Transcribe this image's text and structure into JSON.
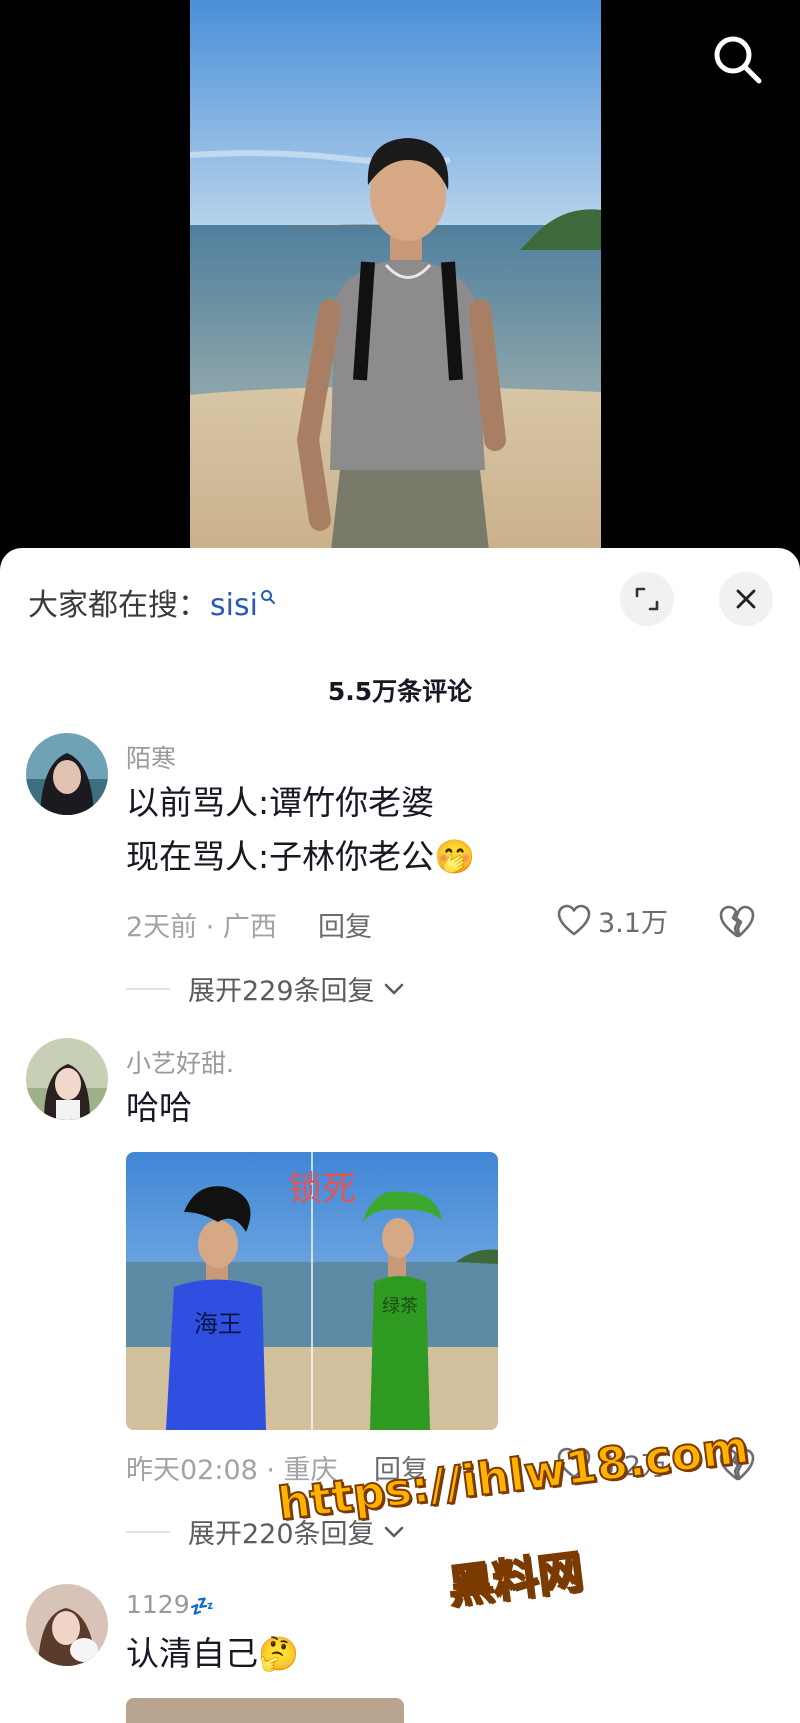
{
  "search_bar": {
    "prefix": "大家都在搜：",
    "keyword": "sisi"
  },
  "comments_header": {
    "count_label": "5.5万条评论"
  },
  "comments": [
    {
      "username": "陌寒",
      "lines": [
        "以前骂人:谭竹你老婆",
        "现在骂人:子林你老公"
      ],
      "emoji": "🤭",
      "time_location": "2天前 · 广西",
      "reply_label": "回复",
      "likes": "3.1万",
      "expand_label": "展开229条回复"
    },
    {
      "username": "小艺好甜.",
      "text": "哈哈",
      "image_caption": "锁死",
      "image_shirt_left": "海王",
      "image_shirt_right": "绿茶",
      "time_location": "昨天02:08 · 重庆",
      "reply_label": "回复",
      "likes": "5.2万",
      "expand_label": "展开220条回复"
    },
    {
      "username": "1129",
      "username_suffix": "💤",
      "text": "认清自己",
      "emoji": "🤔"
    }
  ],
  "watermark": {
    "line1": "https://ihlw18.com",
    "line2": "黑料网"
  },
  "icons": {
    "search": "search-icon",
    "expand": "expand-icon",
    "close": "close-icon",
    "like": "heart-icon",
    "dislike": "broken-heart-icon",
    "chevron": "chevron-down-icon"
  },
  "colors": {
    "keyword": "#2a5ab3",
    "text": "#161823",
    "meta": "#a3a3a7"
  }
}
